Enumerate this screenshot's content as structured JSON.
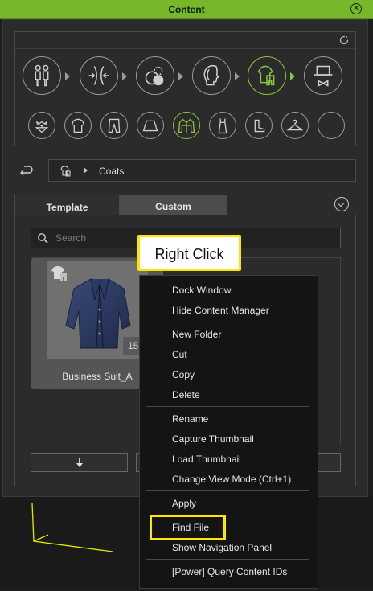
{
  "window": {
    "title": "Content",
    "close_icon": "close-circle-icon"
  },
  "colors": {
    "accent": "#76b82a",
    "highlight": "#ffe600",
    "menu_bg": "#141414"
  },
  "categories": {
    "refresh_icon": "refresh-icon",
    "large": [
      {
        "icon": "characters-icon",
        "active": false
      },
      {
        "icon": "morph-icon",
        "active": false
      },
      {
        "icon": "materials-icon",
        "active": false
      },
      {
        "icon": "head-icon",
        "active": false
      },
      {
        "icon": "clothing-icon",
        "active": true
      },
      {
        "icon": "accessory-icon",
        "active": false
      }
    ],
    "small": [
      {
        "icon": "underwear-icon",
        "active": false
      },
      {
        "icon": "shirt-icon",
        "active": false
      },
      {
        "icon": "pants-icon",
        "active": false
      },
      {
        "icon": "skirt-icon",
        "active": false
      },
      {
        "icon": "coat-icon",
        "active": true
      },
      {
        "icon": "dress-icon",
        "active": false
      },
      {
        "icon": "shoe-icon",
        "active": false
      },
      {
        "icon": "hanger-icon",
        "active": false
      },
      {
        "icon": "empty-icon",
        "active": false
      }
    ]
  },
  "breadcrumb": {
    "folder": "Coats"
  },
  "tabs": {
    "template": "Template",
    "custom": "Custom"
  },
  "search": {
    "placeholder": "Search",
    "value": ""
  },
  "items": [
    {
      "label": "Business Suit_A",
      "count": "15"
    }
  ],
  "callout": {
    "text": "Right Click"
  },
  "context_menu": {
    "groups": [
      [
        "Dock Window",
        "Hide Content Manager"
      ],
      [
        "New Folder",
        "Cut",
        "Copy",
        "Delete"
      ],
      [
        "Rename",
        "Capture Thumbnail",
        "Load Thumbnail",
        "Change View Mode (Ctrl+1)"
      ],
      [
        "Apply"
      ],
      [
        "Find File",
        "Show Navigation Panel"
      ],
      [
        "[Power] Query Content IDs"
      ]
    ]
  }
}
